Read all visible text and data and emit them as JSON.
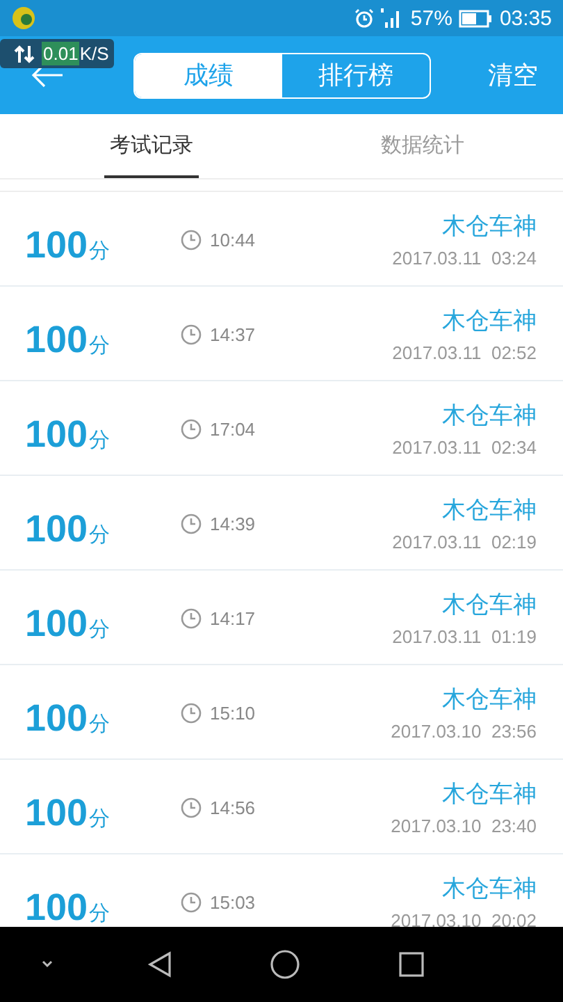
{
  "status_bar": {
    "battery_text": "57%",
    "time": "03:35"
  },
  "speed_badge": {
    "value": "0.01",
    "unit": "K/S"
  },
  "header": {
    "segments": [
      {
        "label": "成绩",
        "selected": true
      },
      {
        "label": "排行榜",
        "selected": false
      }
    ],
    "action": "清空"
  },
  "tabs": [
    {
      "label": "考试记录",
      "selected": true
    },
    {
      "label": "数据统计",
      "selected": false
    }
  ],
  "records": [
    {
      "score": "100",
      "unit": "分",
      "duration": "10:44",
      "name": "木仓车神",
      "date": "2017.03.11  03:24"
    },
    {
      "score": "100",
      "unit": "分",
      "duration": "14:37",
      "name": "木仓车神",
      "date": "2017.03.11  02:52"
    },
    {
      "score": "100",
      "unit": "分",
      "duration": "17:04",
      "name": "木仓车神",
      "date": "2017.03.11  02:34"
    },
    {
      "score": "100",
      "unit": "分",
      "duration": "14:39",
      "name": "木仓车神",
      "date": "2017.03.11  02:19"
    },
    {
      "score": "100",
      "unit": "分",
      "duration": "14:17",
      "name": "木仓车神",
      "date": "2017.03.11  01:19"
    },
    {
      "score": "100",
      "unit": "分",
      "duration": "15:10",
      "name": "木仓车神",
      "date": "2017.03.10  23:56"
    },
    {
      "score": "100",
      "unit": "分",
      "duration": "14:56",
      "name": "木仓车神",
      "date": "2017.03.10  23:40"
    },
    {
      "score": "100",
      "unit": "分",
      "duration": "15:03",
      "name": "木仓车神",
      "date": "2017.03.10  20:02"
    }
  ]
}
